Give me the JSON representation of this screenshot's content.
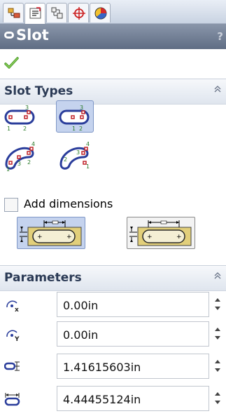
{
  "panel": {
    "title": "Slot",
    "help_glyph": "?"
  },
  "slot_types": {
    "title": "Slot Types",
    "options": [
      {
        "name": "straight-slot",
        "labels": [
          "1",
          "2",
          "3"
        ],
        "selected": false
      },
      {
        "name": "centerpoint-straight-slot",
        "labels": [
          "1",
          "2",
          "3"
        ],
        "selected": true
      },
      {
        "name": "3-point-arc-slot",
        "labels": [
          "1",
          "2",
          "3",
          "4"
        ],
        "selected": false
      },
      {
        "name": "centerpoint-arc-slot",
        "labels": [
          "1",
          "2",
          "3",
          "4"
        ],
        "selected": false
      }
    ],
    "add_dimensions_label": "Add dimensions",
    "add_dimensions_checked": false
  },
  "parameters": {
    "title": "Parameters",
    "fields": [
      {
        "icon": "center-x-icon",
        "value": "0.00in"
      },
      {
        "icon": "center-y-icon",
        "value": "0.00in"
      },
      {
        "icon": "slot-width-icon",
        "value": "1.41615603in"
      },
      {
        "icon": "slot-length-icon",
        "value": "4.44455124in"
      }
    ]
  },
  "colors": {
    "title_bar": "#6b7890",
    "selected_button": "#c5d3ee",
    "slot_outline": "#2a3d9b",
    "endpoint": "#c0242a",
    "dim_fill": "#e2cf7a"
  }
}
